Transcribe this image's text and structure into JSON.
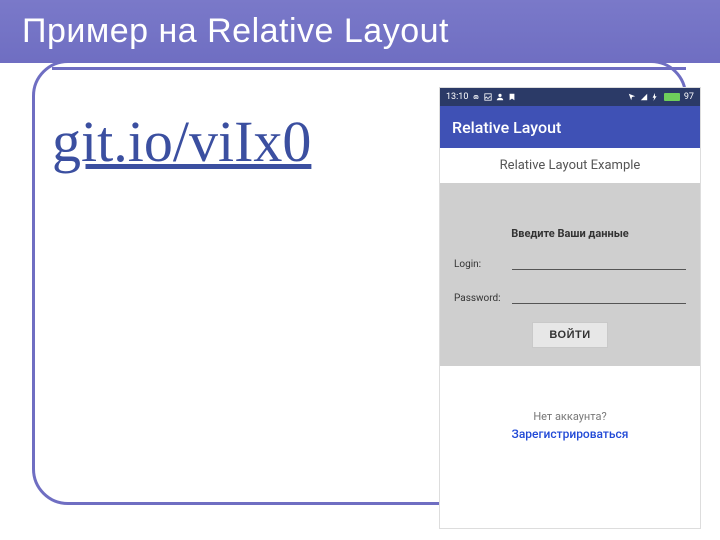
{
  "slide": {
    "title": "Пример на Relative Layout",
    "link_text": "git.io/viIx0"
  },
  "phone": {
    "statusbar": {
      "time": "13:10",
      "battery": "97"
    },
    "appbar_title": "Relative Layout",
    "subtitle": "Relative Layout Example",
    "form": {
      "heading": "Введите Ваши данные",
      "login_label": "Login:",
      "password_label": "Password:",
      "button": "ВОЙТИ"
    },
    "footer": {
      "no_account": "Нет аккаунта?",
      "register": "Зарегистрироваться"
    }
  }
}
